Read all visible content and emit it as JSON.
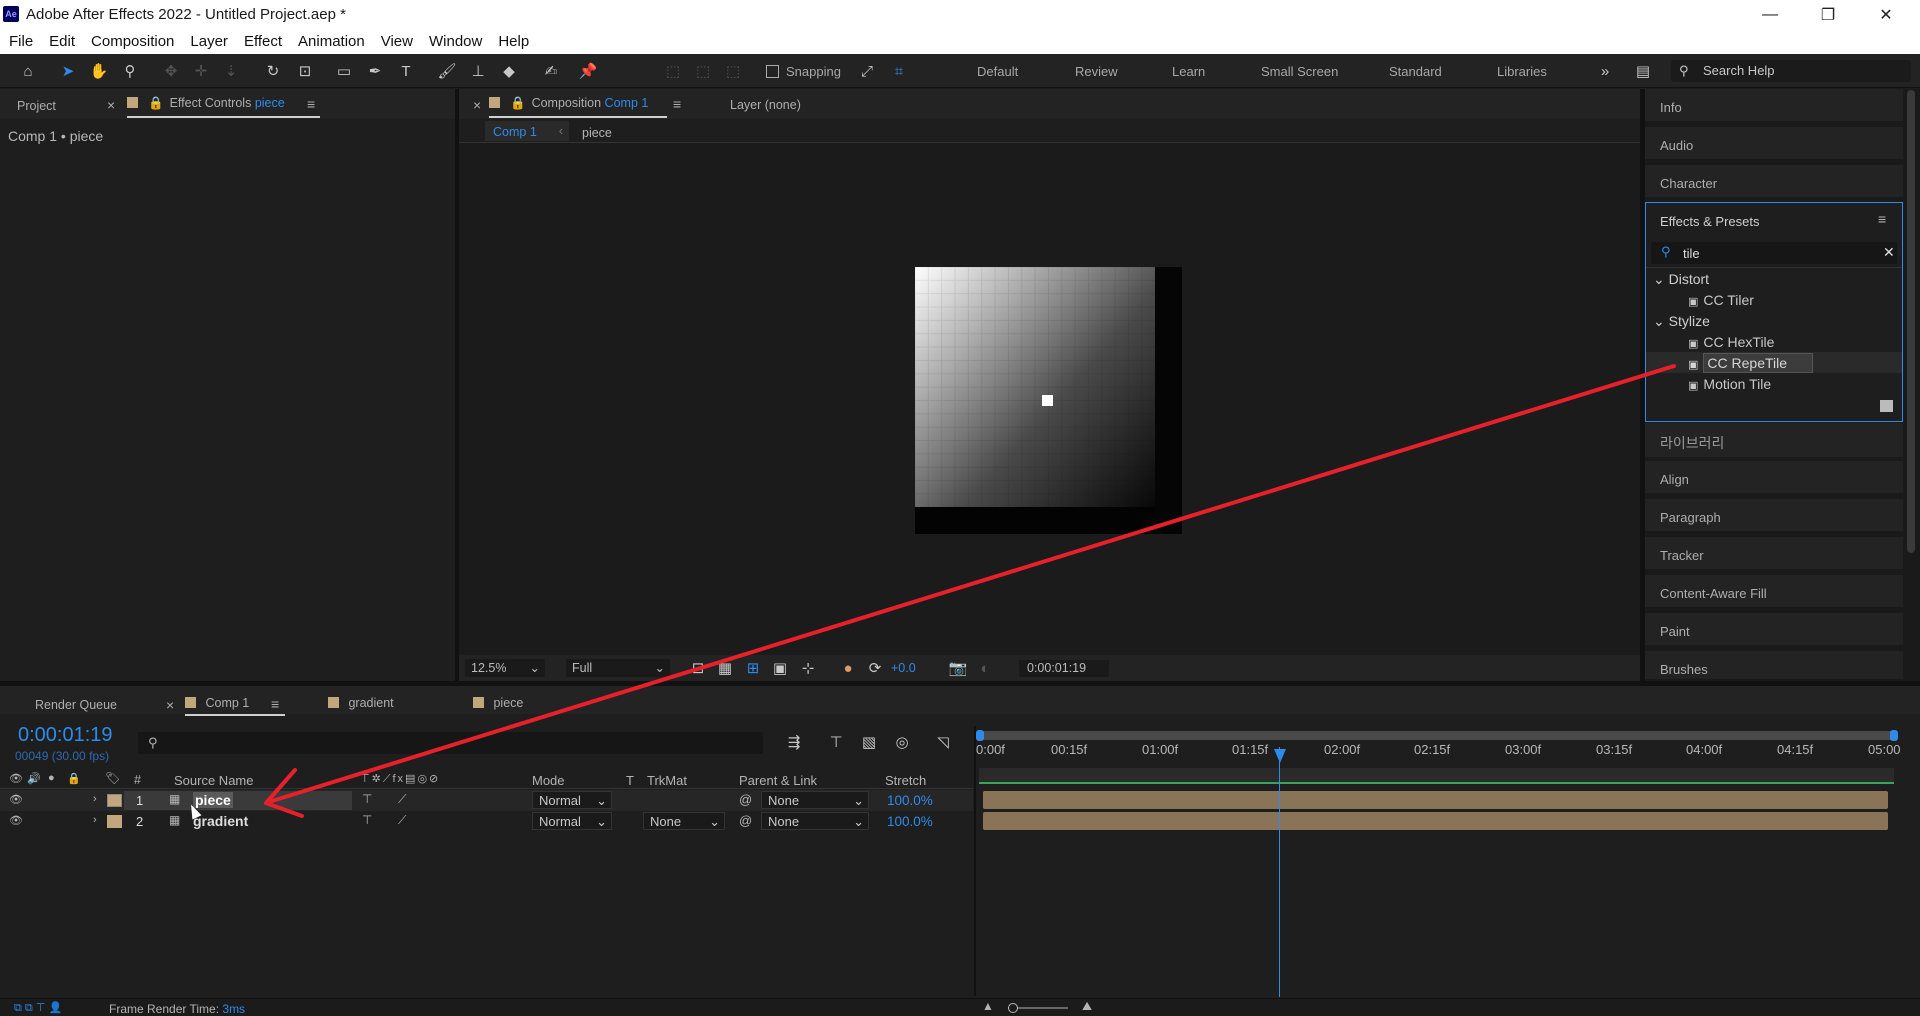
{
  "window": {
    "title": "Adobe After Effects 2022 - Untitled Project.aep *",
    "app_badge": "Ae"
  },
  "menu": [
    "File",
    "Edit",
    "Composition",
    "Layer",
    "Effect",
    "Animation",
    "View",
    "Window",
    "Help"
  ],
  "toolbar": {
    "snapping_label": "Snapping",
    "workspaces": [
      "Default",
      "Review",
      "Learn",
      "Small Screen",
      "Standard",
      "Libraries"
    ],
    "search_placeholder": "Search Help"
  },
  "left_panel": {
    "tab_project": "Project",
    "tab_effect_controls": "Effect Controls",
    "tab_effect_controls_target": "piece",
    "breadcrumb": "Comp 1 • piece"
  },
  "comp_panel": {
    "tab_label": "Composition",
    "tab_comp": "Comp 1",
    "layer_tab": "Layer (none)",
    "sub_tabs": [
      "Comp 1",
      "piece"
    ],
    "zoom": "12.5%",
    "resolution": "Full",
    "exposure": "+0.0",
    "timecode": "0:00:01:19"
  },
  "right_panel": {
    "items_top": [
      "Info",
      "Audio",
      "Character"
    ],
    "effects_title": "Effects & Presets",
    "search_value": "tile",
    "tree": [
      {
        "category": "Distort",
        "items": [
          "CC Tiler"
        ]
      },
      {
        "category": "Stylize",
        "items": [
          "CC HexTile",
          "CC RepeTile",
          "Motion Tile"
        ]
      }
    ],
    "selected_item": "CC RepeTile",
    "library_label": "라이브러리",
    "items_bottom": [
      "Align",
      "Paragraph",
      "Tracker",
      "Content-Aware Fill",
      "Paint",
      "Brushes"
    ]
  },
  "timeline": {
    "tabs": [
      "Render Queue",
      "Comp 1",
      "gradient",
      "piece"
    ],
    "timecode": "0:00:01:19",
    "frame_info": "00049 (30.00 fps)",
    "columns": {
      "source_name": "Source Name",
      "hash": "#",
      "mode": "Mode",
      "t": "T",
      "trkmat": "TrkMat",
      "parent": "Parent & Link",
      "stretch": "Stretch"
    },
    "layers": [
      {
        "num": "1",
        "name": "piece",
        "mode": "Normal",
        "trkmat": "",
        "parent": "None",
        "stretch": "100.0%"
      },
      {
        "num": "2",
        "name": "gradient",
        "mode": "Normal",
        "trkmat": "None",
        "parent": "None",
        "stretch": "100.0%"
      }
    ],
    "ruler": [
      "0:00f",
      "00:15f",
      "01:00f",
      "01:15f",
      "02:00f",
      "02:15f",
      "03:00f",
      "03:15f",
      "04:00f",
      "04:15f",
      "05:00"
    ]
  },
  "status": {
    "label": "Frame Render Time:",
    "value": "3ms"
  },
  "colors": {
    "accent": "#2d8ceb",
    "arrow": "#e8202a",
    "layer_bar": "#8a7457"
  }
}
